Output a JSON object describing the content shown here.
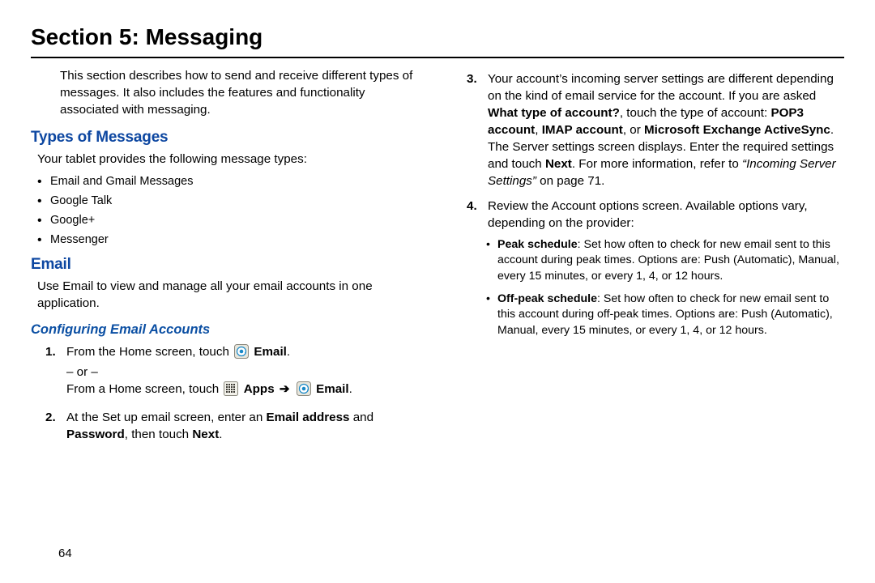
{
  "section_title": "Section 5: Messaging",
  "intro": "This section describes how to send and receive different types of messages. It also includes the features and functionality associated with messaging.",
  "types_heading": "Types of Messages",
  "types_intro": "Your tablet provides the following message types:",
  "types_list": [
    "Email and Gmail Messages",
    "Google Talk",
    "Google+",
    "Messenger"
  ],
  "email_heading": "Email",
  "email_intro": "Use Email to view and manage all your email accounts in one application.",
  "config_heading": "Configuring Email Accounts",
  "step1_a": "From the Home screen, touch ",
  "step1_email": "Email",
  "step1_or": "– or –",
  "step1_b": "From a Home screen, touch ",
  "step1_apps": "Apps",
  "arrow": "➔",
  "step2_a": "At the Set up email screen, enter an ",
  "step2_email_addr": "Email address",
  "step2_and": " and ",
  "step2_password": "Password",
  "step2_then": ", then touch ",
  "step2_next": "Next",
  "step3_a": "Your account’s incoming server settings are different depending on the kind of email service for the account. If you are asked ",
  "step3_q": "What type of account?",
  "step3_b": ", touch the type of account: ",
  "step3_pop3": "POP3 account",
  "step3_c1": ", ",
  "step3_imap": "IMAP account",
  "step3_c2": ", or ",
  "step3_ms": "Microsoft Exchange ActiveSync",
  "step3_d": "The Server settings screen displays. Enter the required settings and touch ",
  "step3_next": "Next",
  "step3_e": ". For more information, refer to ",
  "step3_ref": "“Incoming Server Settings”",
  "step3_onpage": " on page 71.",
  "step4_a": "Review the Account options screen. Available options vary, depending on the provider:",
  "step4_peak_label": "Peak schedule",
  "step4_peak_text": ": Set how often to check for new email sent to this account during peak times. Options are: Push (Automatic), Manual, every 15 minutes, or every 1, 4, or 12 hours.",
  "step4_off_label": "Off-peak schedule",
  "step4_off_text": ": Set how often to check for new email sent to this account during off-peak times. Options are: Push (Automatic), Manual, every 15 minutes, or every 1, 4, or 12 hours.",
  "page_number": "64",
  "chart_data": null
}
